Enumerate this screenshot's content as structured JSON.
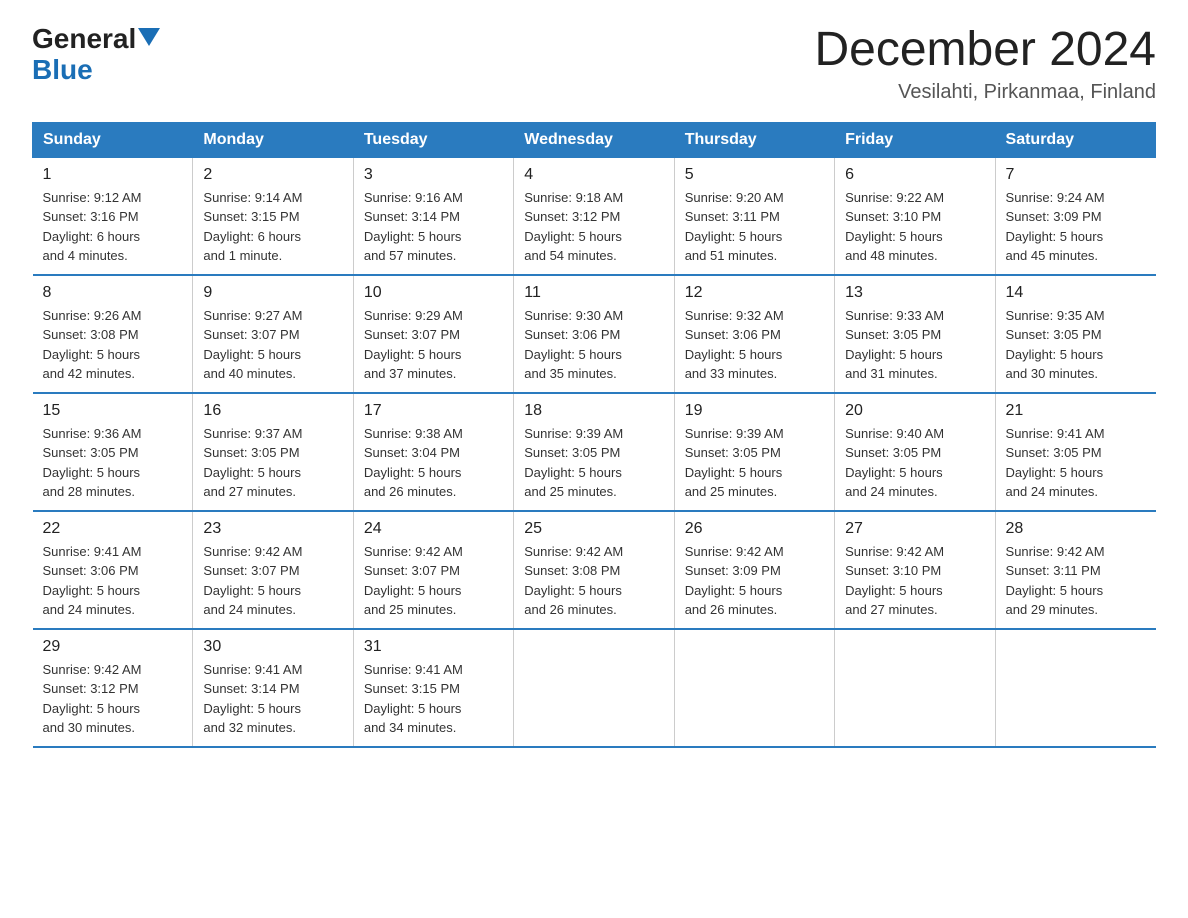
{
  "logo": {
    "general": "General",
    "blue": "Blue",
    "triangle": "▲"
  },
  "title": {
    "month": "December 2024",
    "location": "Vesilahti, Pirkanmaa, Finland"
  },
  "days_of_week": [
    "Sunday",
    "Monday",
    "Tuesday",
    "Wednesday",
    "Thursday",
    "Friday",
    "Saturday"
  ],
  "weeks": [
    [
      {
        "day": "1",
        "info": "Sunrise: 9:12 AM\nSunset: 3:16 PM\nDaylight: 6 hours\nand 4 minutes."
      },
      {
        "day": "2",
        "info": "Sunrise: 9:14 AM\nSunset: 3:15 PM\nDaylight: 6 hours\nand 1 minute."
      },
      {
        "day": "3",
        "info": "Sunrise: 9:16 AM\nSunset: 3:14 PM\nDaylight: 5 hours\nand 57 minutes."
      },
      {
        "day": "4",
        "info": "Sunrise: 9:18 AM\nSunset: 3:12 PM\nDaylight: 5 hours\nand 54 minutes."
      },
      {
        "day": "5",
        "info": "Sunrise: 9:20 AM\nSunset: 3:11 PM\nDaylight: 5 hours\nand 51 minutes."
      },
      {
        "day": "6",
        "info": "Sunrise: 9:22 AM\nSunset: 3:10 PM\nDaylight: 5 hours\nand 48 minutes."
      },
      {
        "day": "7",
        "info": "Sunrise: 9:24 AM\nSunset: 3:09 PM\nDaylight: 5 hours\nand 45 minutes."
      }
    ],
    [
      {
        "day": "8",
        "info": "Sunrise: 9:26 AM\nSunset: 3:08 PM\nDaylight: 5 hours\nand 42 minutes."
      },
      {
        "day": "9",
        "info": "Sunrise: 9:27 AM\nSunset: 3:07 PM\nDaylight: 5 hours\nand 40 minutes."
      },
      {
        "day": "10",
        "info": "Sunrise: 9:29 AM\nSunset: 3:07 PM\nDaylight: 5 hours\nand 37 minutes."
      },
      {
        "day": "11",
        "info": "Sunrise: 9:30 AM\nSunset: 3:06 PM\nDaylight: 5 hours\nand 35 minutes."
      },
      {
        "day": "12",
        "info": "Sunrise: 9:32 AM\nSunset: 3:06 PM\nDaylight: 5 hours\nand 33 minutes."
      },
      {
        "day": "13",
        "info": "Sunrise: 9:33 AM\nSunset: 3:05 PM\nDaylight: 5 hours\nand 31 minutes."
      },
      {
        "day": "14",
        "info": "Sunrise: 9:35 AM\nSunset: 3:05 PM\nDaylight: 5 hours\nand 30 minutes."
      }
    ],
    [
      {
        "day": "15",
        "info": "Sunrise: 9:36 AM\nSunset: 3:05 PM\nDaylight: 5 hours\nand 28 minutes."
      },
      {
        "day": "16",
        "info": "Sunrise: 9:37 AM\nSunset: 3:05 PM\nDaylight: 5 hours\nand 27 minutes."
      },
      {
        "day": "17",
        "info": "Sunrise: 9:38 AM\nSunset: 3:04 PM\nDaylight: 5 hours\nand 26 minutes."
      },
      {
        "day": "18",
        "info": "Sunrise: 9:39 AM\nSunset: 3:05 PM\nDaylight: 5 hours\nand 25 minutes."
      },
      {
        "day": "19",
        "info": "Sunrise: 9:39 AM\nSunset: 3:05 PM\nDaylight: 5 hours\nand 25 minutes."
      },
      {
        "day": "20",
        "info": "Sunrise: 9:40 AM\nSunset: 3:05 PM\nDaylight: 5 hours\nand 24 minutes."
      },
      {
        "day": "21",
        "info": "Sunrise: 9:41 AM\nSunset: 3:05 PM\nDaylight: 5 hours\nand 24 minutes."
      }
    ],
    [
      {
        "day": "22",
        "info": "Sunrise: 9:41 AM\nSunset: 3:06 PM\nDaylight: 5 hours\nand 24 minutes."
      },
      {
        "day": "23",
        "info": "Sunrise: 9:42 AM\nSunset: 3:07 PM\nDaylight: 5 hours\nand 24 minutes."
      },
      {
        "day": "24",
        "info": "Sunrise: 9:42 AM\nSunset: 3:07 PM\nDaylight: 5 hours\nand 25 minutes."
      },
      {
        "day": "25",
        "info": "Sunrise: 9:42 AM\nSunset: 3:08 PM\nDaylight: 5 hours\nand 26 minutes."
      },
      {
        "day": "26",
        "info": "Sunrise: 9:42 AM\nSunset: 3:09 PM\nDaylight: 5 hours\nand 26 minutes."
      },
      {
        "day": "27",
        "info": "Sunrise: 9:42 AM\nSunset: 3:10 PM\nDaylight: 5 hours\nand 27 minutes."
      },
      {
        "day": "28",
        "info": "Sunrise: 9:42 AM\nSunset: 3:11 PM\nDaylight: 5 hours\nand 29 minutes."
      }
    ],
    [
      {
        "day": "29",
        "info": "Sunrise: 9:42 AM\nSunset: 3:12 PM\nDaylight: 5 hours\nand 30 minutes."
      },
      {
        "day": "30",
        "info": "Sunrise: 9:41 AM\nSunset: 3:14 PM\nDaylight: 5 hours\nand 32 minutes."
      },
      {
        "day": "31",
        "info": "Sunrise: 9:41 AM\nSunset: 3:15 PM\nDaylight: 5 hours\nand 34 minutes."
      },
      {
        "day": "",
        "info": ""
      },
      {
        "day": "",
        "info": ""
      },
      {
        "day": "",
        "info": ""
      },
      {
        "day": "",
        "info": ""
      }
    ]
  ]
}
